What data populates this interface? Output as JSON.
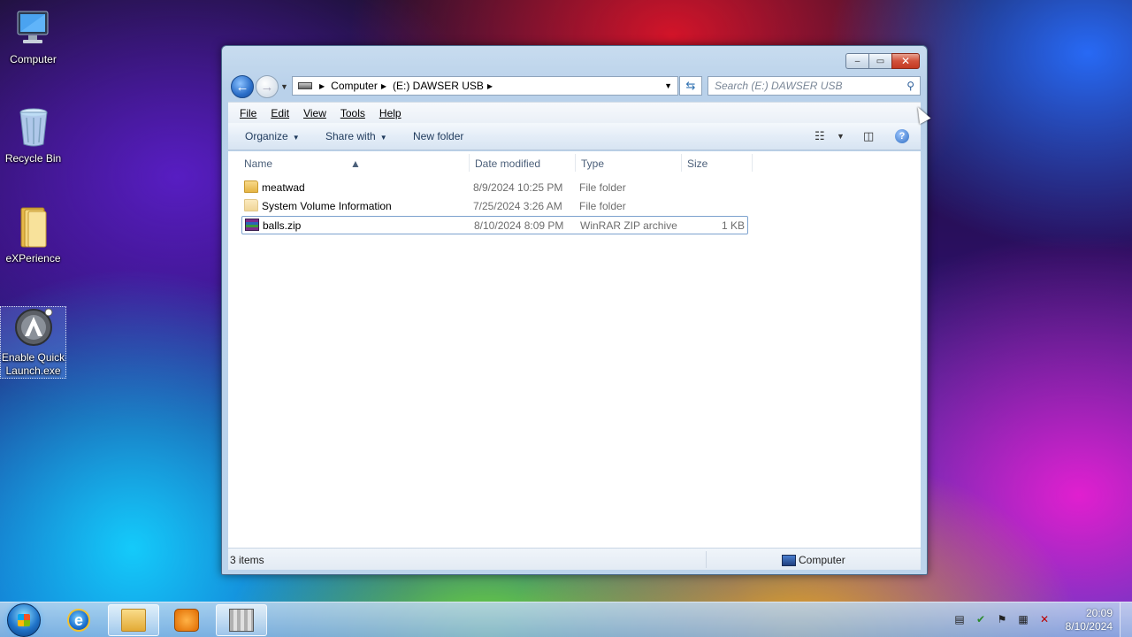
{
  "desktop": {
    "icons": [
      {
        "label": "Computer"
      },
      {
        "label": "Recycle Bin"
      },
      {
        "label": "eXPerience"
      },
      {
        "label": "Enable Quick Launch.exe"
      }
    ]
  },
  "window": {
    "caption": {
      "minimize": "–",
      "maximize": "▭",
      "close": "✕"
    },
    "breadcrumb": [
      "Computer",
      "(E:) DAWSER USB"
    ],
    "search_placeholder": "Search (E:) DAWSER USB",
    "menu": [
      "File",
      "Edit",
      "View",
      "Tools",
      "Help"
    ],
    "commands": {
      "organize": "Organize",
      "share": "Share with",
      "new_folder": "New folder"
    },
    "columns": {
      "name": "Name",
      "date": "Date modified",
      "type": "Type",
      "size": "Size"
    },
    "files": [
      {
        "name": "meatwad",
        "date": "8/9/2024 10:25 PM",
        "type": "File folder",
        "size": "",
        "icon": "folder-icon"
      },
      {
        "name": "System Volume Information",
        "date": "7/25/2024 3:26 AM",
        "type": "File folder",
        "size": "",
        "icon": "folder-icon"
      },
      {
        "name": "balls.zip",
        "date": "8/10/2024 8:09 PM",
        "type": "WinRAR ZIP archive",
        "size": "1 KB",
        "icon": "zip-archive-icon"
      }
    ],
    "status": {
      "count": "3 items",
      "zone": "Computer"
    }
  },
  "taskbar": {
    "clock": {
      "time": "20:09",
      "date": "8/10/2024"
    },
    "pinned": [
      "start-orb",
      "internet-explorer-icon",
      "windows-explorer-icon",
      "media-player-icon",
      "winrar-icon"
    ]
  },
  "colors": {
    "accent": "#2a6ec8",
    "taskbar": "#8cb4e1",
    "window_frame": "#bcd4ec"
  }
}
